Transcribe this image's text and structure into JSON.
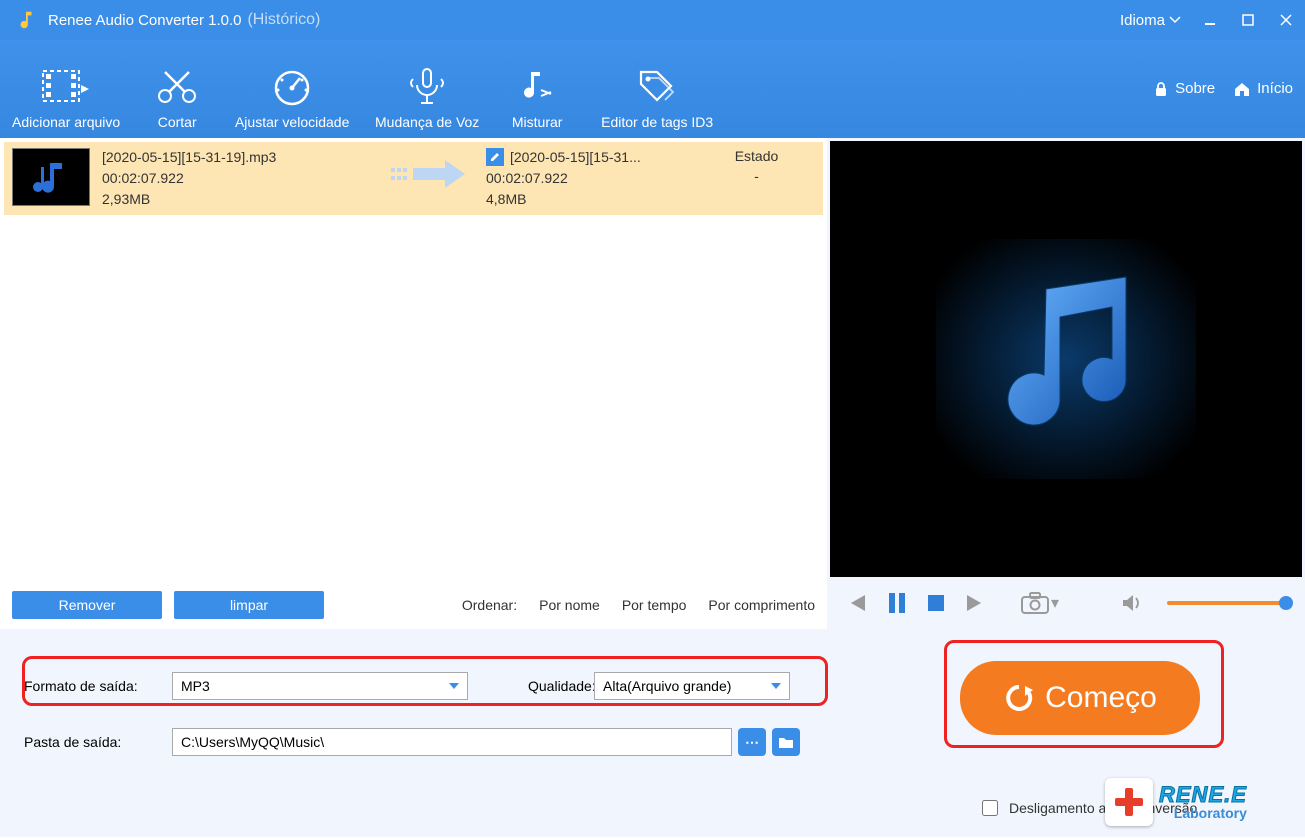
{
  "titlebar": {
    "app_title": "Renee Audio Converter 1.0.0",
    "subtitle": "(Histórico)",
    "language_label": "Idioma"
  },
  "toolbar": {
    "add_file": "Adicionar arquivo",
    "cut": "Cortar",
    "adjust_speed": "Ajustar velocidade",
    "voice_change": "Mudança de Voz",
    "mix": "Misturar",
    "id3_editor": "Editor de tags ID3",
    "about": "Sobre",
    "home": "Início"
  },
  "file": {
    "src_name": "[2020-05-15][15-31-19].mp3",
    "src_duration": "00:02:07.922",
    "src_size": "2,93MB",
    "dst_name": "[2020-05-15][15-31...",
    "dst_duration": "00:02:07.922",
    "dst_size": "4,8MB",
    "state_header": "Estado",
    "state_value": "-"
  },
  "filebar": {
    "remove": "Remover",
    "clear": "limpar",
    "sort_label": "Ordenar:",
    "by_name": "Por nome",
    "by_time": "Por tempo",
    "by_length": "Por comprimento"
  },
  "output": {
    "format_label": "Formato de saída:",
    "format_value": "MP3",
    "quality_label": "Qualidade:",
    "quality_value": "Alta(Arquivo grande)",
    "folder_label": "Pasta de saída:",
    "folder_value": "C:\\Users\\MyQQ\\Music\\"
  },
  "actions": {
    "start": "Começo",
    "shutdown": "Desligamento após conversão"
  },
  "branding": {
    "line1": "RENE.E",
    "line2": "Laboratory"
  }
}
